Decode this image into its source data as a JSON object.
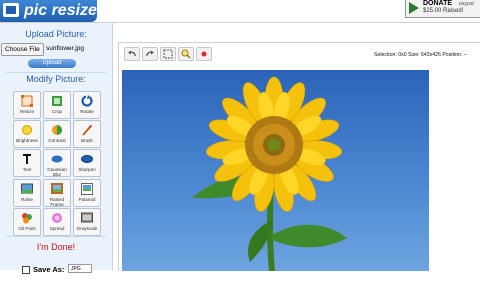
{
  "header": {
    "logo_text": "pic resize",
    "donate": {
      "label": "DONATE",
      "amount": "$25.00 Raised!",
      "extra": "paypal"
    }
  },
  "sidebar": {
    "upload_heading": "Upload Picture:",
    "choose_file_label": "Choose File",
    "file_name": "sunflower.jpg",
    "upload_button": "Upload",
    "modify_heading": "Modify Picture:",
    "tools": [
      {
        "label": "Resize",
        "icon": "resize-icon"
      },
      {
        "label": "Crop",
        "icon": "crop-icon"
      },
      {
        "label": "Rotate",
        "icon": "rotate-icon"
      },
      {
        "label": "Brightness",
        "icon": "brightness-icon"
      },
      {
        "label": "Contrast",
        "icon": "contrast-icon"
      },
      {
        "label": "Brush",
        "icon": "brush-icon"
      },
      {
        "label": "Text",
        "icon": "text-icon"
      },
      {
        "label": "Gaussian Blur",
        "icon": "blur-icon"
      },
      {
        "label": "Sharpen",
        "icon": "sharpen-icon"
      },
      {
        "label": "Raise",
        "icon": "raise-icon"
      },
      {
        "label": "Raised Frame",
        "icon": "raised-frame-icon"
      },
      {
        "label": "Polaroid",
        "icon": "polaroid-icon"
      },
      {
        "label": "Oil Paint",
        "icon": "oil-paint-icon"
      },
      {
        "label": "Spread",
        "icon": "spread-icon"
      },
      {
        "label": "Grayscale",
        "icon": "grayscale-icon"
      }
    ],
    "done_label": "I'm Done!",
    "save_as_label": "Save As:",
    "save_format": "JPG"
  },
  "editor": {
    "toolbar": [
      "undo-icon",
      "redo-icon",
      "select-icon",
      "zoom-icon",
      "delete-icon"
    ],
    "status": "Selection: 0x0 Size: 643x426 Position: --"
  },
  "colors": {
    "brand": "#2f6fc2",
    "sidebar_bg": "#eaf2fb",
    "done": "#cc1111",
    "sky": "#3f7cc8"
  }
}
